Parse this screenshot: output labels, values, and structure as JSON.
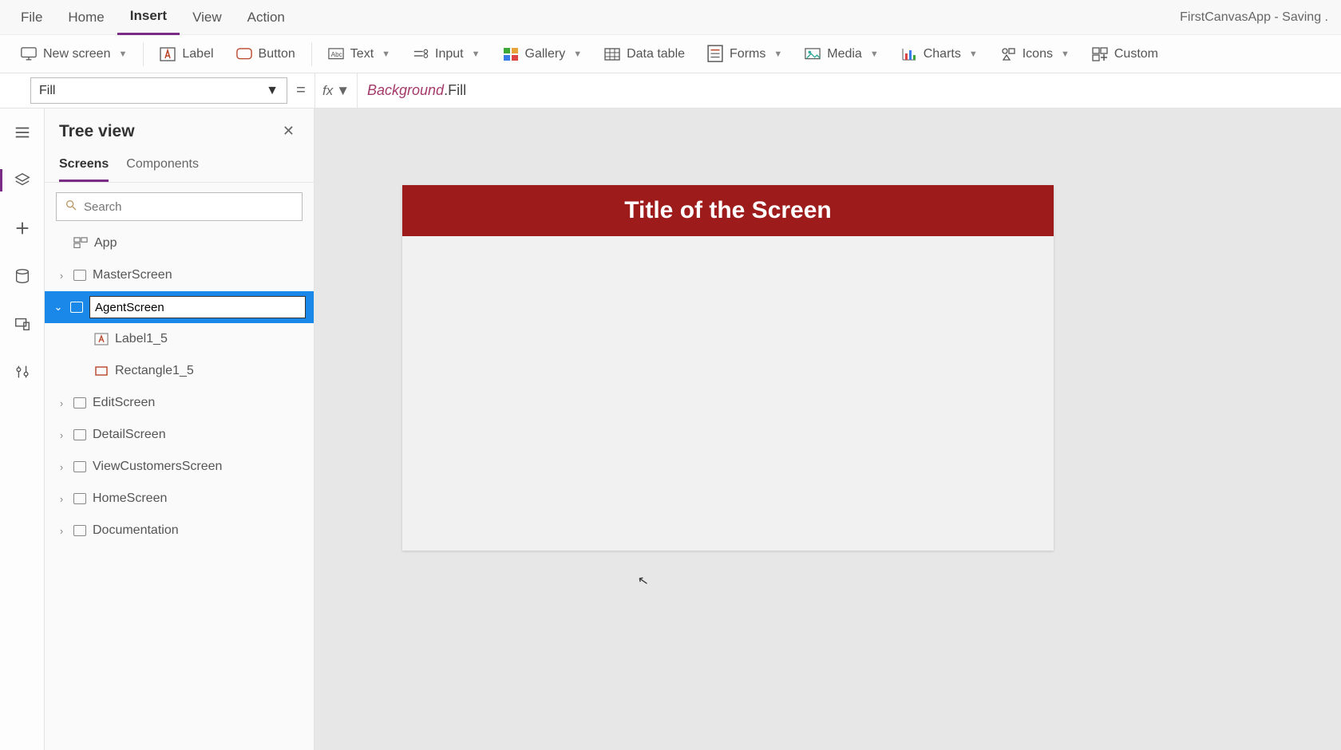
{
  "menu": {
    "file": "File",
    "home": "Home",
    "insert": "Insert",
    "view": "View",
    "action": "Action"
  },
  "appTitle": "FirstCanvasApp - Saving .",
  "ribbon": {
    "newScreen": "New screen",
    "label": "Label",
    "button": "Button",
    "text": "Text",
    "input": "Input",
    "gallery": "Gallery",
    "dataTable": "Data table",
    "forms": "Forms",
    "media": "Media",
    "charts": "Charts",
    "icons": "Icons",
    "custom": "Custom"
  },
  "propSelector": "Fill",
  "formula": {
    "obj": "Background",
    "prop": ".Fill"
  },
  "tree": {
    "title": "Tree view",
    "tabs": {
      "screens": "Screens",
      "components": "Components"
    },
    "searchPlaceholder": "Search",
    "app": "App",
    "items": {
      "master": "MasterScreen",
      "agentEdit": "AgentScreen",
      "label1": "Label1_5",
      "rect1": "Rectangle1_5",
      "edit": "EditScreen",
      "detail": "DetailScreen",
      "viewCust": "ViewCustomersScreen",
      "homeScr": "HomeScreen",
      "doc": "Documentation"
    }
  },
  "canvas": {
    "title": "Title of the Screen"
  }
}
